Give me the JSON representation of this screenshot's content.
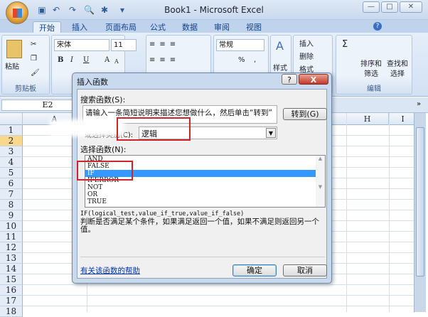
{
  "window": {
    "title": "Book1 - Microsoft Excel",
    "min": "—",
    "max": "□",
    "close": "✕"
  },
  "tabs": [
    "开始",
    "插入",
    "页面布局",
    "公式",
    "数据",
    "审阅",
    "视图"
  ],
  "ribbon": {
    "clipboard": {
      "paste": "粘贴",
      "label": "剪贴板"
    },
    "font": {
      "name": "宋体",
      "size": "11",
      "bold": "B",
      "italic": "I",
      "underline": "U",
      "grow": "A",
      "shrink": "A"
    },
    "number": {
      "format": "常规",
      "percent": "%",
      "comma": ","
    },
    "styles": {
      "label": "样式"
    },
    "cells": {
      "insert": "插入",
      "delete": "删除",
      "format": "格式"
    },
    "editing": {
      "sum": "Σ",
      "sort": "排序和筛选",
      "find": "查找和选择",
      "label": "编辑"
    }
  },
  "namebox": "E2",
  "columns": [
    "A",
    "H",
    "I"
  ],
  "rows": [
    "1",
    "2",
    "3",
    "4",
    "5",
    "6",
    "7",
    "8",
    "9",
    "10",
    "11",
    "12",
    "13",
    "14",
    "15",
    "16",
    "17",
    "18"
  ],
  "dialog": {
    "title": "插入函数",
    "help": "?",
    "close": "X",
    "search_label": "搜索函数(S):",
    "search_value": "请输入一条简短说明来描述您想做什么，然后单击“转到”",
    "go": "转到(G)",
    "category_label": "或选择类别(C):",
    "category_value": "逻辑",
    "function_label": "选择函数(N):",
    "functions": [
      "AND",
      "FALSE",
      "IF",
      "IFERROR",
      "NOT",
      "OR",
      "TRUE"
    ],
    "selected": "IF",
    "signature": "IF(logical_test,value_if_true,value_if_false)",
    "description": "判断是否满足某个条件，如果满足返回一个值，如果不满足则返回另一个值。",
    "help_link": "有关该函数的帮助",
    "ok": "确定",
    "cancel": "取消"
  }
}
